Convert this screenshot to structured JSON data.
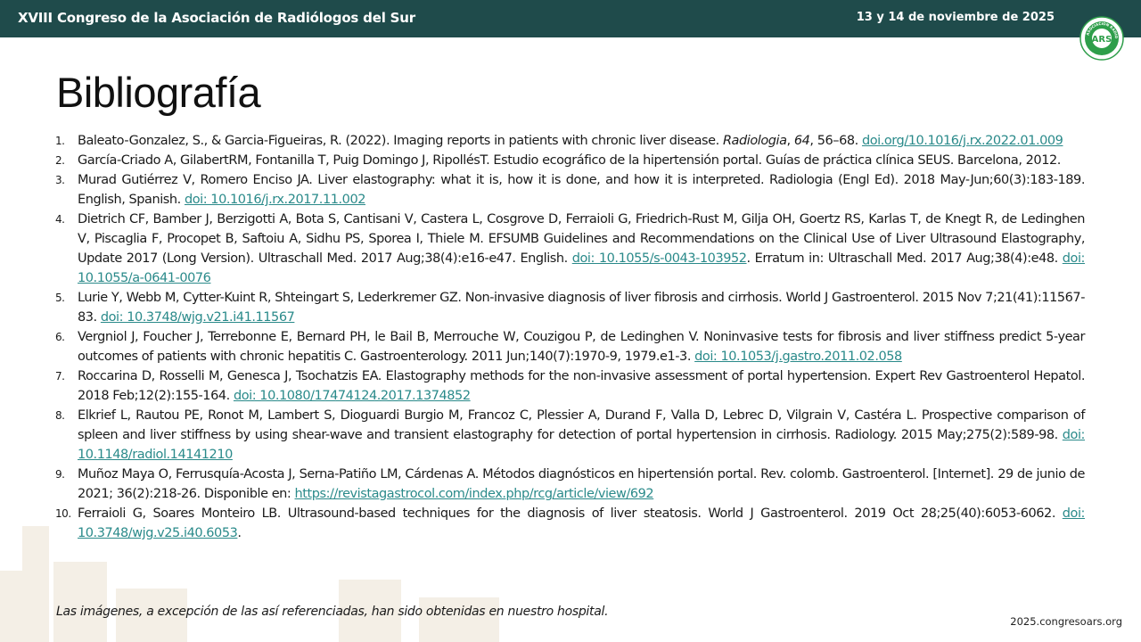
{
  "header": {
    "event_title": "XVIII Congreso de la Asociación de Radiólogos del Sur",
    "date": "13 y 14 de noviembre de 2025",
    "logo_text": "ARS",
    "logo_ring_text": "ASOCIACION RADIOLOGOS SUR"
  },
  "colors": {
    "header_bg": "#1f4b4b",
    "link": "#2a8a8a",
    "logo_green": "#2e9e4a"
  },
  "page": {
    "title": "Bibliografía"
  },
  "references": [
    {
      "n": "1.",
      "text": "Baleato-Gonzalez, S., & Garcia-Figueiras, R. (2022). Imaging reports in patients with chronic liver disease. ",
      "italic": "Radiologia",
      "sep1": ", ",
      "italic2": "64",
      "rest": ", 56–68. ",
      "link": "doi.org/10.1016/j.rx.2022.01.009",
      "after": ""
    },
    {
      "n": "2.",
      "text": "García-Criado A, GilabertRM, Fontanilla T, Puig Domingo J, RipollésT. Estudio ecográfico de la hipertensión portal. Guías de práctica clínica SEUS. Barcelona, 2012.",
      "link": "",
      "after": ""
    },
    {
      "n": "3.",
      "text": "Murad Gutiérrez V, Romero Enciso JA. Liver elastography: what it is, how it is done, and how it is interpreted. Radiologia (Engl Ed). 2018 May-Jun;60(3):183-189. English, Spanish. ",
      "link": "doi: 10.1016/j.rx.2017.11.002",
      "after": ""
    },
    {
      "n": "4.",
      "text": "Dietrich CF, Bamber J, Berzigotti A, Bota S, Cantisani V, Castera L, Cosgrove D, Ferraioli G, Friedrich-Rust M, Gilja OH, Goertz RS, Karlas T, de Knegt R, de Ledinghen V, Piscaglia F, Procopet B, Saftoiu A, Sidhu PS, Sporea I, Thiele M. EFSUMB Guidelines and Recommendations on the Clinical Use of Liver Ultrasound Elastography, Update 2017 (Long Version). Ultraschall Med. 2017 Aug;38(4):e16-e47. English. ",
      "link": "doi: 10.1055/s-0043-103952",
      "after": ". Erratum in: Ultraschall Med. 2017 Aug;38(4):e48. ",
      "link2": "doi: 10.1055/a-0641-0076"
    },
    {
      "n": "5.",
      "text": "Lurie Y, Webb M, Cytter-Kuint R, Shteingart S, Lederkremer GZ. Non-invasive diagnosis of liver fibrosis and cirrhosis. World J Gastroenterol. 2015 Nov 7;21(41):11567-83. ",
      "link": "doi: 10.3748/wjg.v21.i41.11567",
      "after": ""
    },
    {
      "n": "6.",
      "text": "Vergniol J, Foucher J, Terrebonne E, Bernard PH, le Bail B, Merrouche W, Couzigou P, de Ledinghen V. Noninvasive tests for fibrosis and liver stiffness predict 5-year outcomes of patients with chronic hepatitis C. Gastroenterology. 2011 Jun;140(7):1970-9, 1979.e1-3. ",
      "link": "doi: 10.1053/j.gastro.2011.02.058",
      "after": ""
    },
    {
      "n": "7.",
      "text": "Roccarina D, Rosselli M, Genesca J, Tsochatzis EA. Elastography methods for the non-invasive assessment of portal hypertension. Expert Rev Gastroenterol Hepatol. 2018 Feb;12(2):155-164. ",
      "link": "doi: 10.1080/17474124.2017.1374852",
      "after": ""
    },
    {
      "n": "8.",
      "text": "Elkrief L, Rautou PE, Ronot M, Lambert S, Dioguardi Burgio M, Francoz C, Plessier A, Durand F, Valla D, Lebrec D, Vilgrain V, Castéra L. Prospective comparison of spleen and liver stiffness by using shear-wave and transient elastography for detection of portal hypertension in cirrhosis. Radiology. 2015 May;275(2):589-98. ",
      "link": "doi: 10.1148/radiol.14141210",
      "after": ""
    },
    {
      "n": "9.",
      "text": "Muñoz Maya O, Ferrusquía-Acosta J, Serna-Patiño LM, Cárdenas A. Métodos diagnósticos en hipertensión portal. Rev. colomb. Gastroenterol. [Internet]. 29 de junio de 2021; 36(2):218-26. Disponible en: ",
      "link": "https://revistagastrocol.com/index.php/rcg/article/view/692",
      "after": ""
    },
    {
      "n": "10.",
      "text": "Ferraioli G, Soares Monteiro LB. Ultrasound-based techniques for the diagnosis of liver steatosis. World J Gastroenterol. 2019 Oct 28;25(40):6053-6062. ",
      "link": "doi: 10.3748/wjg.v25.i40.6053",
      "after": "."
    }
  ],
  "footnote": "Las imágenes, a excepción de las así referenciadas, han sido obtenidas en nuestro hospital.",
  "website": "2025.congresoars.org"
}
